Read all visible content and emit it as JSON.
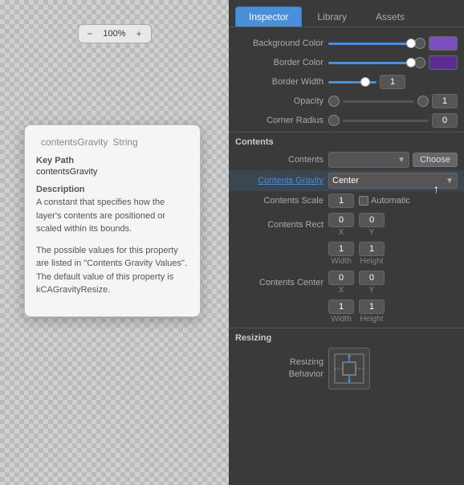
{
  "toolbar": {
    "zoom_out_label": "−",
    "zoom_level": "100%",
    "zoom_in_label": "+"
  },
  "tooltip": {
    "title": "contentsGravity",
    "type": "String",
    "key_path_label": "Key Path",
    "key_path_value": "contentsGravity",
    "description_label": "Description",
    "description_text": "A constant that specifies how the layer's contents are positioned or scaled within its bounds.",
    "extra_text": "The possible values for this property are listed in \"Contents Gravity Values\". The default value of this property is kCAGravityResize."
  },
  "tabs": [
    {
      "label": "Inspector",
      "active": true
    },
    {
      "label": "Library",
      "active": false
    },
    {
      "label": "Assets",
      "active": false
    }
  ],
  "inspector": {
    "background_color_label": "Background Color",
    "border_color_label": "Border Color",
    "border_width_label": "Border Width",
    "border_width_value": "1",
    "opacity_label": "Opacity",
    "opacity_value": "1",
    "corner_radius_label": "Corner Radius",
    "corner_radius_value": "0",
    "contents_section": "Contents",
    "contents_label": "Contents",
    "choose_label": "Choose",
    "contents_gravity_label": "Contents Gravity",
    "contents_gravity_value": "Center",
    "contents_scale_label": "Contents Scale",
    "contents_scale_value": "1",
    "automatic_label": "Automatic",
    "contents_rect_label": "Contents Rect",
    "rect_x1": "0",
    "rect_y1": "0",
    "rect_x_label": "X",
    "rect_y_label": "Y",
    "rect_w": "1",
    "rect_h": "1",
    "rect_w_label": "Width",
    "rect_h_label": "Height",
    "contents_center_label": "Contents Center",
    "center_x1": "0",
    "center_y1": "0",
    "center_x_label": "X",
    "center_y_label": "Y",
    "center_w": "1",
    "center_h": "1",
    "center_w_label": "Width",
    "center_h_label": "Height",
    "resizing_section": "Resizing",
    "resizing_behavior_label": "Resizing\nBehavior",
    "bg_color_hex": "#7B4FBF",
    "border_color_hex": "#5C2D91"
  }
}
